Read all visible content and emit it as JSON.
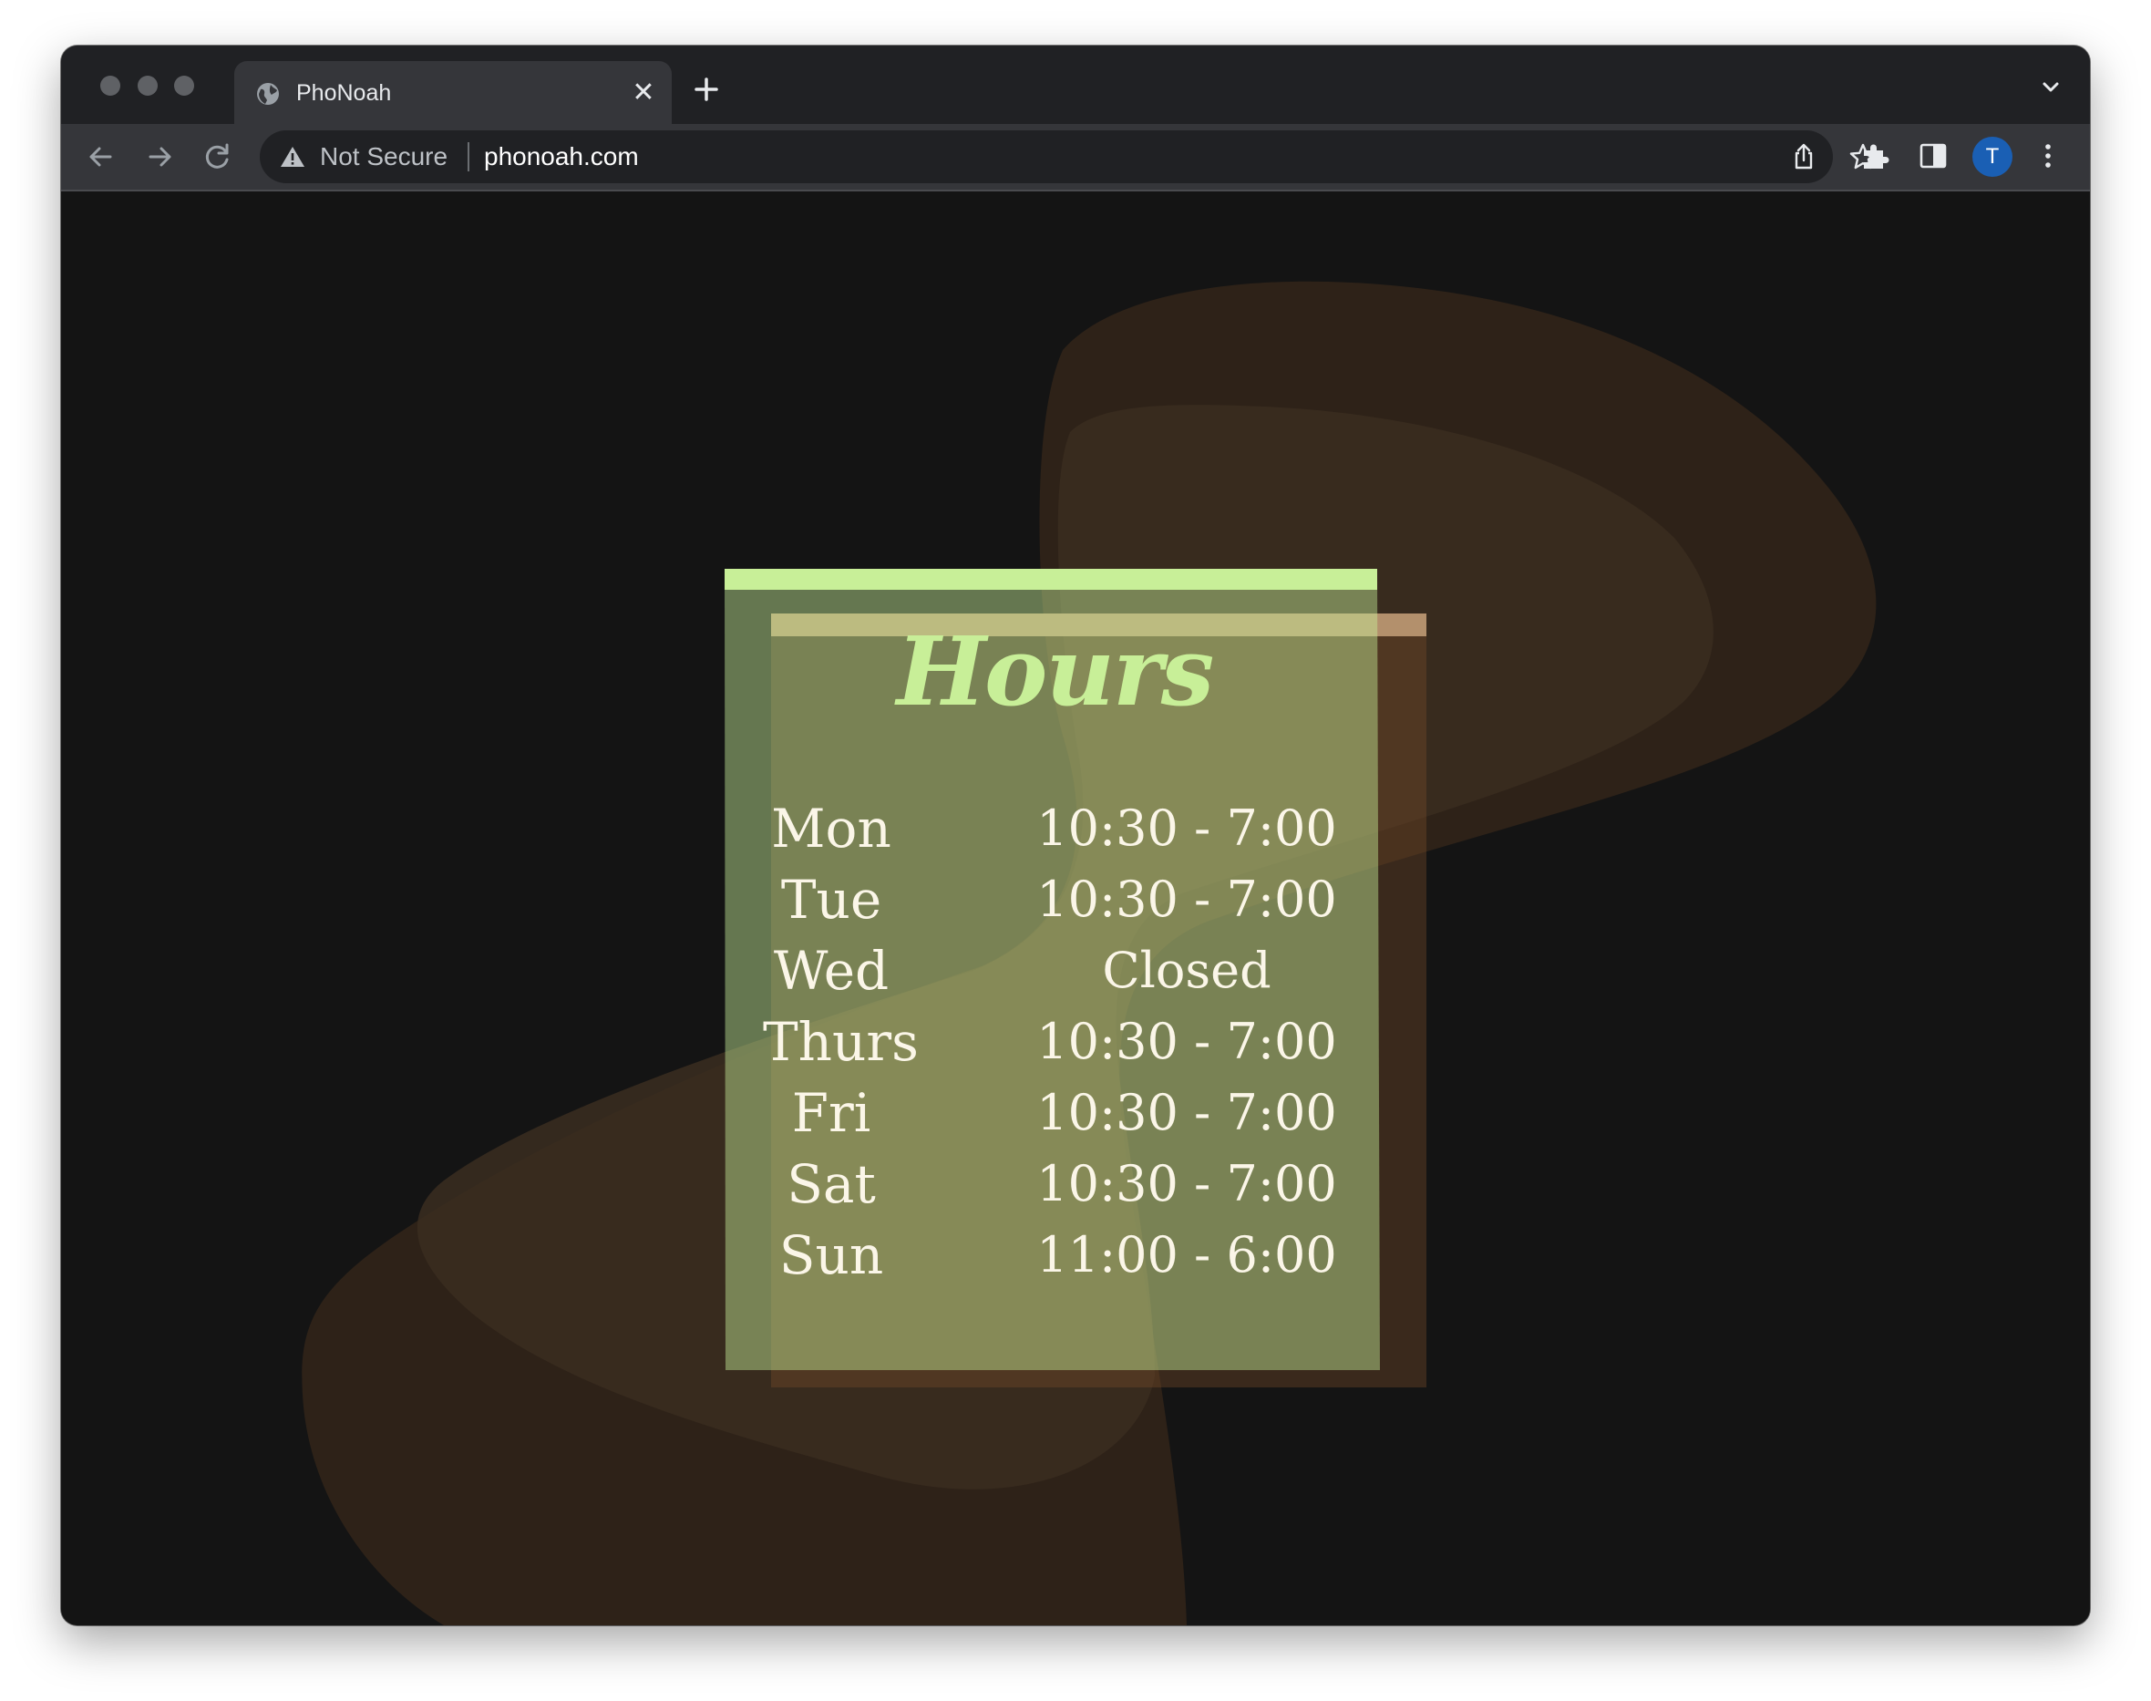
{
  "browser": {
    "tab_title": "PhoNoah",
    "security_label": "Not Secure",
    "url": "phonoah.com",
    "profile_initial": "T"
  },
  "colors": {
    "page_background": "#141414",
    "title_accent": "#c8ef98",
    "card_accent_top": "#c8ef98",
    "card_accent_back": "#b3906c",
    "text_light": "#fbf6e8"
  },
  "hours": {
    "title": "Hours",
    "rows": [
      {
        "day": "Mon",
        "time": "10:30 - 7:00"
      },
      {
        "day": "Tue",
        "time": "10:30 - 7:00"
      },
      {
        "day": "Wed",
        "time": "Closed"
      },
      {
        "day": "Thurs",
        "time": "10:30 - 7:00"
      },
      {
        "day": "Fri",
        "time": "10:30 - 7:00"
      },
      {
        "day": "Sat",
        "time": "10:30 - 7:00"
      },
      {
        "day": "Sun",
        "time": "11:00 - 6:00"
      }
    ]
  },
  "icons": {
    "tab_favicon": "globe-icon",
    "tab_close": "close-icon",
    "new_tab": "plus-icon",
    "tab_search": "chevron-down-icon",
    "back": "arrow-left-icon",
    "forward": "arrow-right-icon",
    "reload": "reload-icon",
    "security": "warning-triangle-icon",
    "share": "share-icon",
    "bookmark": "star-icon",
    "extensions": "puzzle-icon",
    "side_panel": "side-panel-icon",
    "menu": "kebab-menu-icon"
  }
}
